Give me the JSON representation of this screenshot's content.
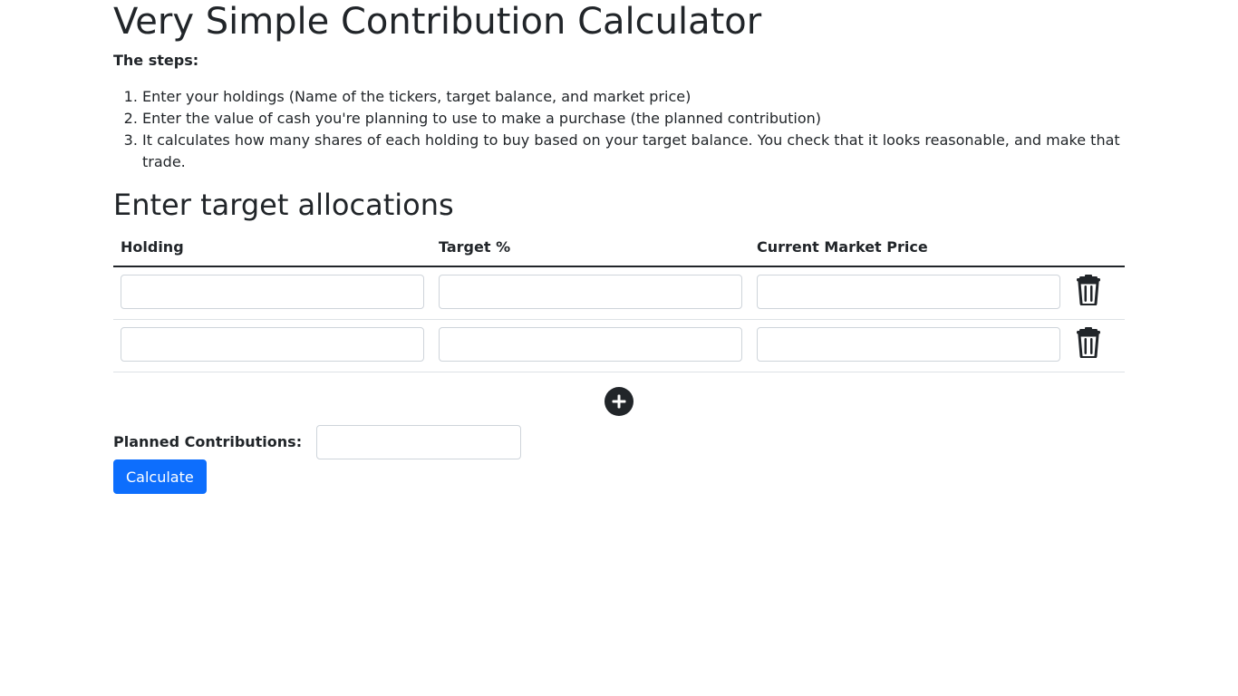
{
  "page": {
    "title": "Very Simple Contribution Calculator",
    "steps_label": "The steps:",
    "steps": [
      "Enter your holdings (Name of the tickers, target balance, and market price)",
      "Enter the value of cash you're planning to use to make a purchase (the planned contribution)",
      "It calculates how many shares of each holding to buy based on your target balance. You check that it looks reasonable, and make that trade."
    ]
  },
  "allocations": {
    "heading": "Enter target allocations",
    "columns": [
      "Holding",
      "Target %",
      "Current Market Price"
    ],
    "rows": [
      {
        "holding": "",
        "target": "",
        "price": ""
      },
      {
        "holding": "",
        "target": "",
        "price": ""
      }
    ],
    "delete_icon": "trash-icon",
    "add_icon": "plus-circle-icon"
  },
  "contribution": {
    "label": "Planned Contributions:",
    "value": ""
  },
  "actions": {
    "calculate_label": "Calculate"
  },
  "colors": {
    "primary": "#0d6efd",
    "text": "#212529",
    "border": "#dee2e6"
  }
}
